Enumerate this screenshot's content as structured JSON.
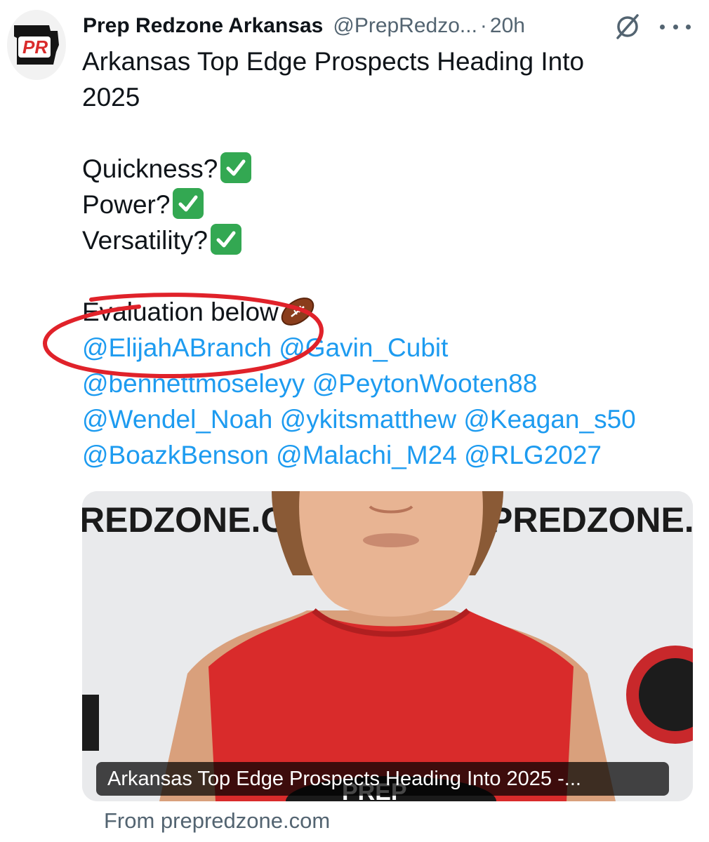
{
  "author": {
    "display_name": "Prep Redzone Arkansas",
    "handle": "@PrepRedzo...",
    "separator": "·",
    "time": "20h",
    "avatar_letters": "PR"
  },
  "actions": {
    "grok_icon": "grok-icon",
    "more_icon": "more-icon"
  },
  "tweet": {
    "line1": "Arkansas Top Edge Prospects Heading Into",
    "line2": "2025",
    "quickness": "Quickness?",
    "power": "Power?",
    "versatility": "Versatility?",
    "evaluation": "Evaluation below",
    "mentions": [
      "@ElijahABranch",
      "@Gavin_Cubit",
      "@bennettmoseleyy",
      "@PeytonWooten88",
      "@Wendel_Noah",
      "@ykitsmatthew",
      "@Keagan_s50",
      "@BoazkBenson",
      "@Malachi_M24",
      "@RLG2027"
    ]
  },
  "card": {
    "backdrop_left": "REDZONE.CO",
    "backdrop_right": "PREDZONE.C",
    "shirt_text": "PREP",
    "caption": "Arkansas Top Edge Prospects Heading Into 2025 -...",
    "source": "From prepredzone.com"
  },
  "colors": {
    "link": "#1d9bf0",
    "text": "#0f1419",
    "muted": "#536471",
    "check": "#33a852",
    "annotation": "#e0222a",
    "jersey": "#d92b2b"
  }
}
